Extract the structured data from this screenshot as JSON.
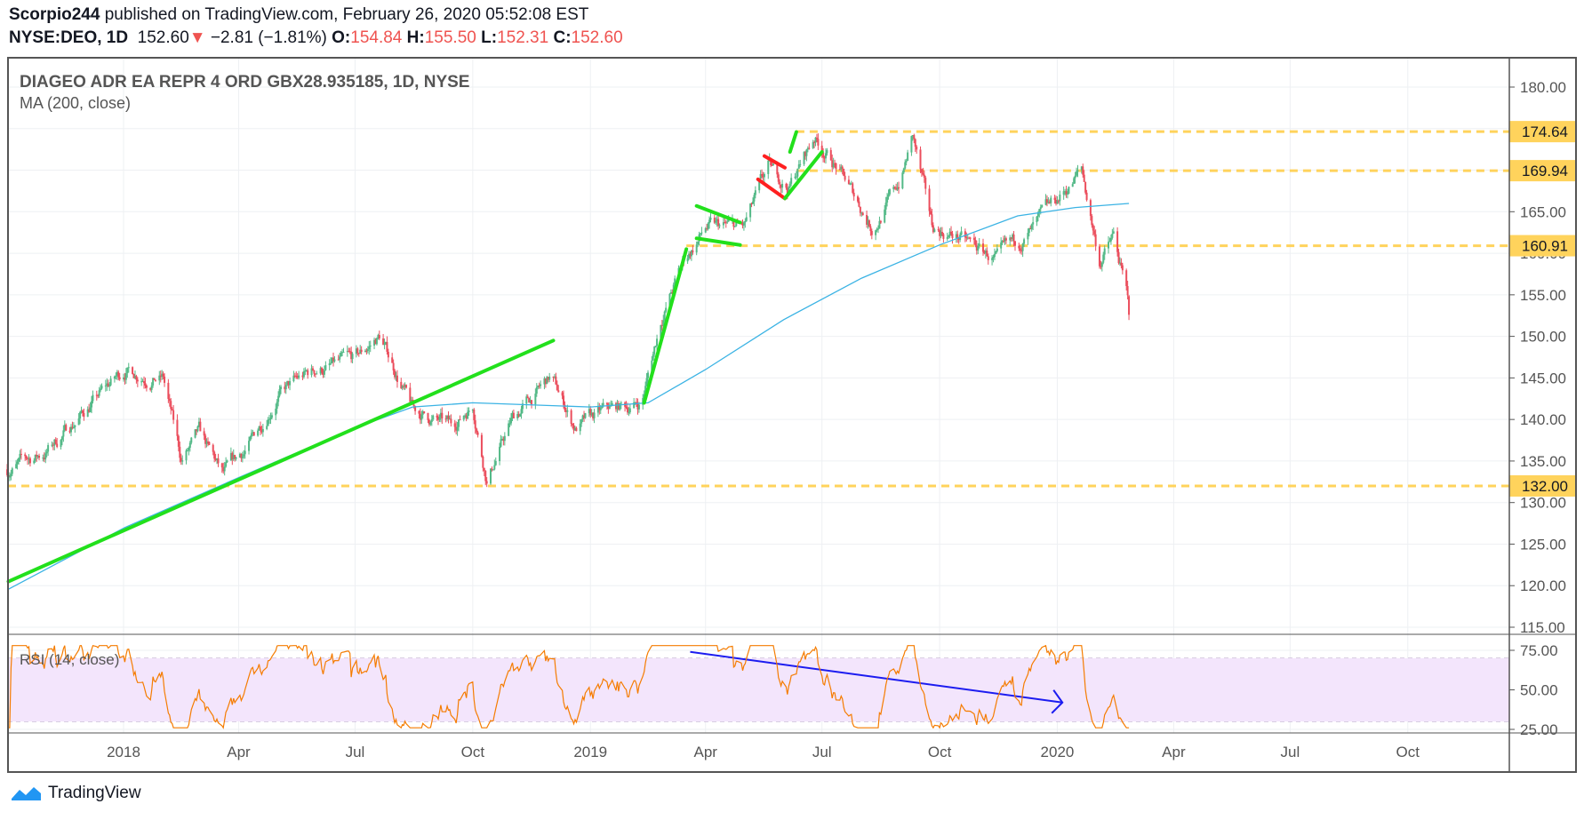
{
  "header": {
    "author": "Scorpio244",
    "published": "published on TradingView.com, February 26, 2020 05:52:08 EST",
    "symbol": "NYSE:DEO, 1D",
    "last": "152.60",
    "change": "−2.81 (−1.81%)",
    "o_label": "O:",
    "o": "154.84",
    "h_label": "H:",
    "h": "155.50",
    "l_label": "L:",
    "l": "152.31",
    "c_label": "C:",
    "c": "152.60"
  },
  "footer": {
    "brand": "TradingView"
  },
  "colors": {
    "up": "#53b987",
    "down": "#eb4d5c",
    "ma": "#3bb3e4",
    "rsi": "#f57c00",
    "level": "#ffd35c",
    "trend": "#22e01c",
    "flag_red": "#ff2020",
    "arrow": "#1c1cf0",
    "rsi_band": "#f3e5fc"
  },
  "chart_data": {
    "type": "candlestick",
    "title": "DIAGEO ADR EA REPR 4 ORD GBX28.935185, 1D, NYSE",
    "indicator_label": "MA (200, close)",
    "rsi_label": "RSI (14, close)",
    "ylim": [
      115,
      180
    ],
    "rsi_ylim": [
      25,
      75
    ],
    "y_ticks": [
      "180.00",
      "175.00",
      "170.00",
      "165.00",
      "160.00",
      "155.00",
      "150.00",
      "145.00",
      "140.00",
      "135.00",
      "130.00",
      "125.00",
      "120.00",
      "115.00"
    ],
    "rsi_ticks": [
      "75.00",
      "50.00",
      "25.00"
    ],
    "x_ticks": [
      {
        "date": "2018-01-01",
        "label": "2018"
      },
      {
        "date": "2018-04-01",
        "label": "Apr"
      },
      {
        "date": "2018-07-01",
        "label": "Jul"
      },
      {
        "date": "2018-10-01",
        "label": "Oct"
      },
      {
        "date": "2019-01-01",
        "label": "2019"
      },
      {
        "date": "2019-04-01",
        "label": "Apr"
      },
      {
        "date": "2019-07-01",
        "label": "Jul"
      },
      {
        "date": "2019-10-01",
        "label": "Oct"
      },
      {
        "date": "2020-01-01",
        "label": "2020"
      },
      {
        "date": "2020-04-01",
        "label": "Apr"
      },
      {
        "date": "2020-07-01",
        "label": "Jul"
      },
      {
        "date": "2020-10-01",
        "label": "Oct"
      }
    ],
    "price_path": [
      [
        "2017-10-02",
        134
      ],
      [
        "2017-11-01",
        136
      ],
      [
        "2017-12-01",
        141
      ],
      [
        "2018-01-02",
        146
      ],
      [
        "2018-02-01",
        145
      ],
      [
        "2018-02-15",
        135
      ],
      [
        "2018-03-01",
        138
      ],
      [
        "2018-03-20",
        133
      ],
      [
        "2018-04-10",
        137
      ],
      [
        "2018-05-01",
        143
      ],
      [
        "2018-06-01",
        146
      ],
      [
        "2018-07-01",
        147
      ],
      [
        "2018-07-20",
        150
      ],
      [
        "2018-08-01",
        146
      ],
      [
        "2018-08-15",
        141
      ],
      [
        "2018-09-15",
        139
      ],
      [
        "2018-10-01",
        142
      ],
      [
        "2018-10-12",
        133
      ],
      [
        "2018-11-01",
        140
      ],
      [
        "2018-12-01",
        145
      ],
      [
        "2018-12-20",
        139
      ],
      [
        "2019-01-15",
        141
      ],
      [
        "2019-02-10",
        142
      ],
      [
        "2019-02-25",
        152
      ],
      [
        "2019-03-15",
        159
      ],
      [
        "2019-04-01",
        163
      ],
      [
        "2019-05-01",
        163
      ],
      [
        "2019-05-20",
        170
      ],
      [
        "2019-06-05",
        168
      ],
      [
        "2019-06-25",
        174
      ],
      [
        "2019-07-10",
        171
      ],
      [
        "2019-08-10",
        163
      ],
      [
        "2019-09-01",
        169
      ],
      [
        "2019-09-10",
        174
      ],
      [
        "2019-09-25",
        163
      ],
      [
        "2019-10-15",
        162
      ],
      [
        "2019-11-15",
        159
      ],
      [
        "2019-12-15",
        163
      ],
      [
        "2020-01-05",
        167
      ],
      [
        "2020-01-20",
        170
      ],
      [
        "2020-02-03",
        159
      ],
      [
        "2020-02-14",
        162
      ],
      [
        "2020-02-24",
        155
      ],
      [
        "2020-02-26",
        152.6
      ]
    ],
    "ma_path": [
      [
        "2017-10-02",
        119.5
      ],
      [
        "2018-01-02",
        127
      ],
      [
        "2018-04-01",
        133
      ],
      [
        "2018-07-01",
        139
      ],
      [
        "2018-08-15",
        141.5
      ],
      [
        "2018-10-01",
        142
      ],
      [
        "2019-01-01",
        141.5
      ],
      [
        "2019-02-15",
        142
      ],
      [
        "2019-04-01",
        146
      ],
      [
        "2019-06-01",
        152
      ],
      [
        "2019-08-01",
        157
      ],
      [
        "2019-10-01",
        161
      ],
      [
        "2019-12-01",
        164.5
      ],
      [
        "2020-01-15",
        165.5
      ],
      [
        "2020-02-26",
        166
      ]
    ],
    "levels": [
      {
        "value": 174.64,
        "label": "174.64",
        "from": "2019-06-11"
      },
      {
        "value": 169.94,
        "label": "169.94",
        "from": "2019-06-11"
      },
      {
        "value": 160.91,
        "label": "160.91",
        "from": "2019-03-17"
      },
      {
        "value": 132.0,
        "label": "132.00",
        "from": "2017-10-01"
      }
    ],
    "trendlines": [
      {
        "color": "trend",
        "from": [
          "2017-10-03",
          120.5
        ],
        "to": [
          "2018-12-03",
          149.5
        ]
      },
      {
        "color": "trend",
        "from": [
          "2019-02-12",
          142
        ],
        "to": [
          "2019-03-17",
          160.5
        ]
      },
      {
        "color": "trend",
        "from": [
          "2019-03-25",
          165.7
        ],
        "to": [
          "2019-04-28",
          163.7
        ]
      },
      {
        "color": "trend",
        "from": [
          "2019-03-25",
          161.8
        ],
        "to": [
          "2019-04-28",
          161.0
        ]
      },
      {
        "color": "flag_red",
        "from": [
          "2019-05-17",
          171.7
        ],
        "to": [
          "2019-06-02",
          170.3
        ]
      },
      {
        "color": "flag_red",
        "from": [
          "2019-05-12",
          168.9
        ],
        "to": [
          "2019-06-02",
          166.6
        ]
      },
      {
        "color": "trend",
        "from": [
          "2019-06-02",
          166.6
        ],
        "to": [
          "2019-07-01",
          172.2
        ]
      },
      {
        "color": "trend",
        "from": [
          "2019-06-06",
          172.2
        ],
        "to": [
          "2019-06-11",
          174.6
        ]
      }
    ],
    "rsi_arrow": {
      "from": [
        "2019-03-20",
        74
      ],
      "to": [
        "2020-01-05",
        42
      ]
    }
  }
}
